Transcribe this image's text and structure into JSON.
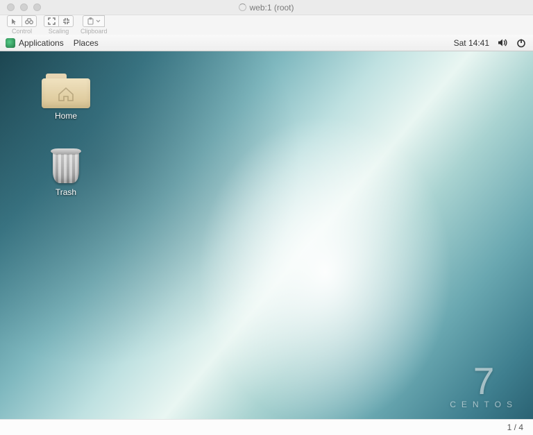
{
  "mac_window": {
    "title": "web:1 (root)"
  },
  "vnc_toolbar": {
    "control_label": "Control",
    "scaling_label": "Scaling",
    "clipboard_label": "Clipboard"
  },
  "gnome_panel": {
    "applications": "Applications",
    "places": "Places",
    "clock": "Sat 14:41"
  },
  "desktop_icons": {
    "home": "Home",
    "trash": "Trash"
  },
  "branding": {
    "version": "7",
    "distro": "CENTOS"
  },
  "status_bar": {
    "page_indicator": "1 / 4"
  }
}
